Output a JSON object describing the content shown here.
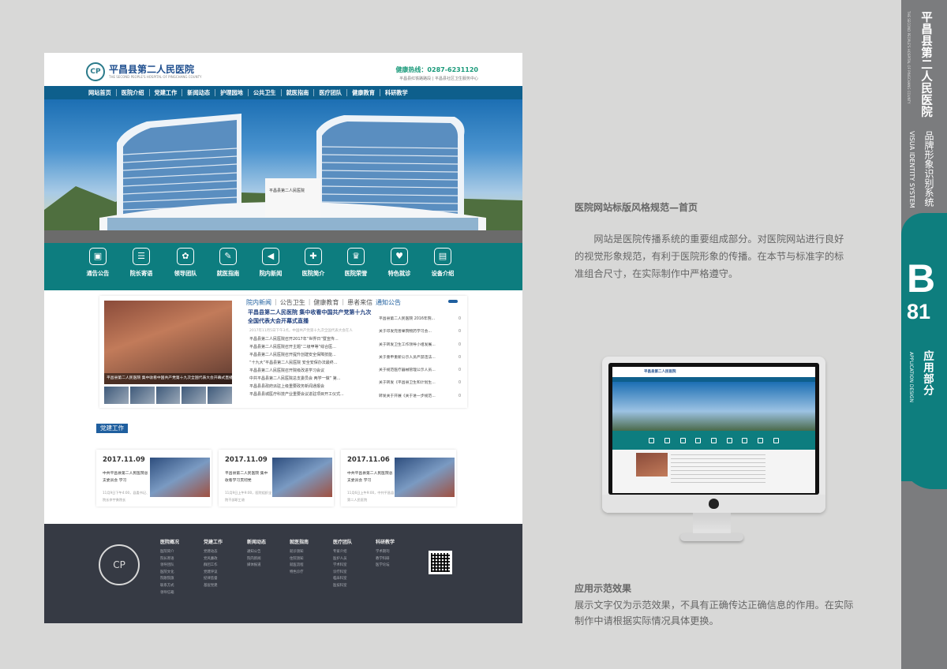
{
  "site": {
    "hospital_name": "平昌县第二人民医院",
    "hospital_name_en": "THE SECOND PEOPLE'S HOSPITAL OF PINGCHANG COUNTY",
    "logo_mark": "CP",
    "hotline": "健康热线：0287-6231120",
    "hotline_sub": "平昌县红铁路路段 | 平昌县社区卫生服务中心",
    "nav": [
      "网站首页",
      "医院介绍",
      "党建工作",
      "新闻动态",
      "护理园地",
      "公共卫生",
      "就医指南",
      "医疗团队",
      "健康教育",
      "科研教学"
    ],
    "hero_sign": "平昌县第二人民医院",
    "quick_links": [
      {
        "icon": "notice-icon",
        "glyph": "▣",
        "label": "通告公告"
      },
      {
        "icon": "letter-icon",
        "glyph": "☰",
        "label": "院长寄语"
      },
      {
        "icon": "team-icon",
        "glyph": "✿",
        "label": "领导团队"
      },
      {
        "icon": "guide-icon",
        "glyph": "✎",
        "label": "就医指南"
      },
      {
        "icon": "news-icon",
        "glyph": "◀",
        "label": "院内新闻"
      },
      {
        "icon": "hospital-icon",
        "glyph": "✚",
        "label": "医院简介"
      },
      {
        "icon": "trophy-icon",
        "glyph": "♛",
        "label": "医院荣誉"
      },
      {
        "icon": "clinic-icon",
        "glyph": "♥",
        "label": "特色就诊"
      },
      {
        "icon": "device-icon",
        "glyph": "▤",
        "label": "设备介绍"
      }
    ],
    "news_tabs": [
      "院内新闻",
      "公告卫生",
      "健康教育",
      "患者来信"
    ],
    "news_photo_caption": "平昌县第二人民医院 集中收看中国共产党第十九次全国代表大会开幕式直播",
    "headline": "平昌县第二人民医院 集中收看中国共产党第十九次全国代表大会开幕式直播",
    "headline_desc": "2017年11月5日下午3点，中国共产党第十九次全国代表大会在人",
    "news_items": [
      "平昌县第二人民医院召开2017年“世界日”暨宣传...",
      "平昌县第二人民医院召开主题“二级甲等”综合医...",
      "平昌县第二人民医院召开提升创建安全保障技能...",
      "“十九大”平昌县第二人民医院 安全安保办法最终...",
      "平昌县第二人民医院召开院级改进学习会议",
      "中共平昌县第二人民医院总支委员会 两学一做” 第...",
      "平昌县县政府派驻上级重要政务新闻通报会",
      "平昌县县城医疗科技产业重要会议进驻项目开工仪式..."
    ],
    "notice_title": "通知公告",
    "notices": [
      {
        "text": "平昌县第二人民医院 2016年院...",
        "date": "0"
      },
      {
        "text": "关于印发完善果院物药学习会...",
        "date": "0"
      },
      {
        "text": "关于转发卫生工作领导小组发展...",
        "date": "0"
      },
      {
        "text": "关于重申重新公示人员严禁违法...",
        "date": "0"
      },
      {
        "text": "关于规范医疗器械管理公示人员...",
        "date": "0"
      },
      {
        "text": "关于转发《平昌县卫生和计划生...",
        "date": "0"
      },
      {
        "text": "转发关于开展《关于进一步规范...",
        "date": "0"
      }
    ],
    "party_tag": "党建工作",
    "party_cards": [
      {
        "date": "2017.11.09",
        "title": "中共平昌县第二人民医院总支委员会 学习",
        "desc": "11月9日下午4:00，县委书记、院长李宇勇院长"
      },
      {
        "date": "2017.11.09",
        "title": "平昌县第二人民医院 集中收看学习贯彻党",
        "desc": "11月9日上午9:00，医院组织全院干部职工收"
      },
      {
        "date": "2017.11.06",
        "title": "中共平昌县第二人民医院总支委员会 学习",
        "desc": "11月6日上午9:00，中共平昌县第二人民医院"
      }
    ],
    "footer_columns": [
      {
        "head": "医院概况",
        "items": [
          "医院简介",
          "院长寄语",
          "领导团队",
          "医院文化",
          "院歌院旗",
          "联系方式",
          "领导信箱"
        ]
      },
      {
        "head": "党建工作",
        "items": [
          "党建动态",
          "党风廉政",
          "群团工作",
          "党建评议",
          "纪律监督",
          "基层党建"
        ]
      },
      {
        "head": "新闻动态",
        "items": [
          "通知公告",
          "院内新闻",
          "媒体报道"
        ]
      },
      {
        "head": "就医指南",
        "items": [
          "就诊须知",
          "住院须知",
          "就医流程",
          "特色诊疗"
        ]
      },
      {
        "head": "医疗团队",
        "items": [
          "专家介绍",
          "医护人员",
          "学术科室",
          "诊疗科室",
          "临床科室",
          "医技科室"
        ]
      },
      {
        "head": "科研教学",
        "items": [
          "学术期刊",
          "教学科研",
          "医学论坛"
        ]
      }
    ]
  },
  "doc": {
    "section_title": "医院网站标版风格规范—首页",
    "section_body": "网站是医院传播系统的重要组成部分。对医院网站进行良好的视觉形象规范，有利于医院形象的传播。在本节与标准字的标准组合尺寸，在实际制作中严格遵守。",
    "app_title": "应用示范效果",
    "app_body": "展示文字仅为示范效果，不具有正确传达正确信息的作用。在实际制作中请根据实际情况具体更换。"
  },
  "side": {
    "hospital_name": "平昌县第二人民医院",
    "hospital_name_en": "THE SECOND PEOPLE'S HOSPITAL OF PINGCHANG COUNTY",
    "vi_title": "品牌形象识别系统",
    "vi_title_en": "VISUA IDENTITY SYSTEM",
    "section_letter": "B",
    "page_number": "81",
    "section_name": "应用部分",
    "section_name_en": "APPLICATION DESIGN"
  },
  "colors": {
    "teal": "#0d7d7f",
    "nav_blue": "#0e5f8c",
    "side_gray": "#7b7c7e",
    "footer_dark": "#363a44"
  }
}
